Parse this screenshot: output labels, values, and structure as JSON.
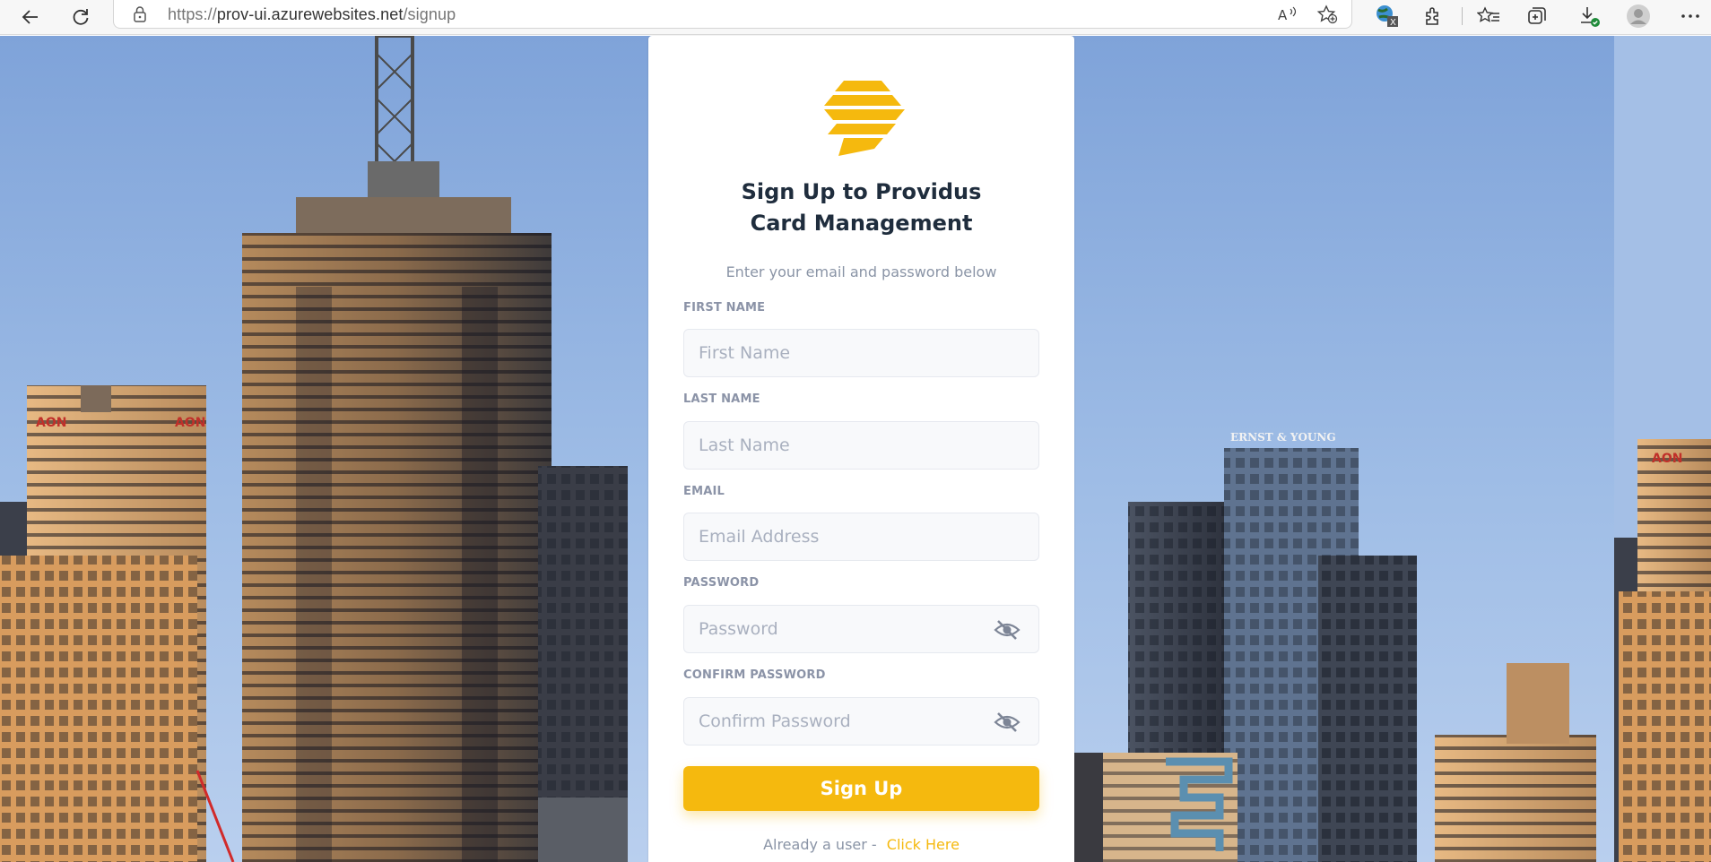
{
  "browser": {
    "url_protocol": "https://",
    "url_host": "prov-ui.azurewebsites.net",
    "url_path": "/signup"
  },
  "form": {
    "title_line1": "Sign Up to Providus",
    "title_line2": "Card Management",
    "subtitle": "Enter your email and password below",
    "fields": [
      {
        "label": "FIRST NAME",
        "placeholder": "First Name",
        "value": ""
      },
      {
        "label": "LAST NAME",
        "placeholder": "Last Name",
        "value": ""
      },
      {
        "label": "EMAIL",
        "placeholder": "Email Address",
        "value": ""
      },
      {
        "label": "PASSWORD",
        "placeholder": "Password",
        "value": ""
      },
      {
        "label": "CONFIRM PASSWORD",
        "placeholder": "Confirm Password",
        "value": ""
      }
    ],
    "submit_label": "Sign Up",
    "already_text": "Already a user - ",
    "login_link": "Click Here"
  },
  "colors": {
    "accent": "#f5b90e",
    "title": "#1f2d3d",
    "muted": "#8a94a6",
    "sky": "#8fb1e0"
  },
  "background_sign_texts": [
    "AON",
    "AON",
    "ERNST & YOUNG",
    "AON"
  ]
}
